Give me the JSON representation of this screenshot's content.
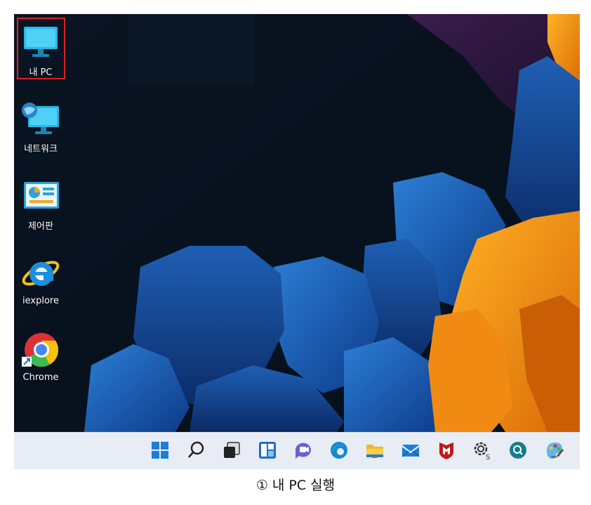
{
  "desktop": {
    "icons": [
      {
        "label": "내 PC",
        "icon": "computer-icon"
      },
      {
        "label": "네트워크",
        "icon": "network-icon"
      },
      {
        "label": "제어판",
        "icon": "control-panel-icon"
      },
      {
        "label": "iexplore",
        "icon": "internet-explorer-icon"
      },
      {
        "label": "Chrome",
        "icon": "chrome-icon"
      }
    ],
    "highlight_color": "#e02020"
  },
  "taskbar": {
    "icons": [
      "windows-start-icon",
      "search-icon",
      "task-view-icon",
      "widgets-icon",
      "teams-chat-icon",
      "edge-icon",
      "file-explorer-icon",
      "mail-icon",
      "mcafee-icon",
      "settings-icon",
      "quick-assist-icon",
      "paint-icon"
    ]
  },
  "caption": {
    "text": "① 내 PC 실행"
  }
}
